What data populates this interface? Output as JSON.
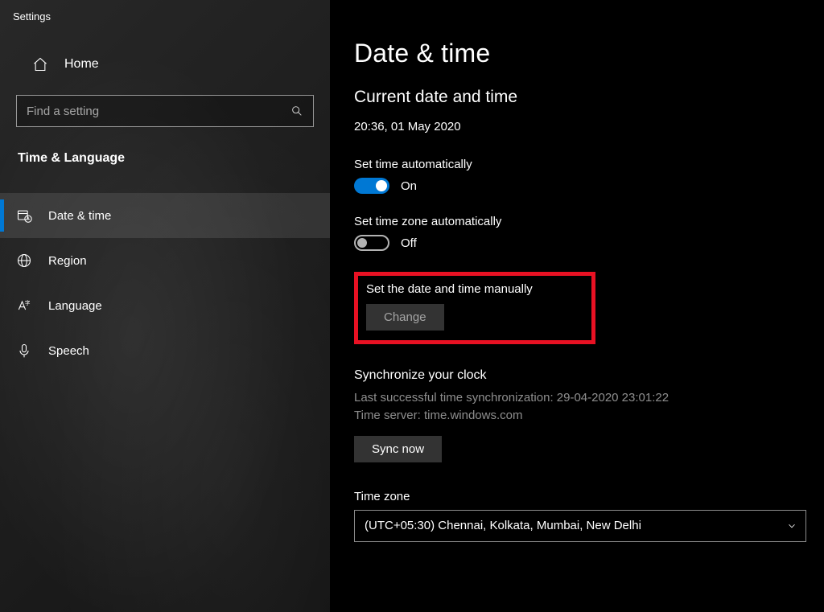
{
  "app_title": "Settings",
  "home_label": "Home",
  "search_placeholder": "Find a setting",
  "section": "Time & Language",
  "nav": [
    {
      "label": "Date & time"
    },
    {
      "label": "Region"
    },
    {
      "label": "Language"
    },
    {
      "label": "Speech"
    }
  ],
  "page": {
    "title": "Date & time",
    "current_heading": "Current date and time",
    "current_value": "20:36, 01 May 2020",
    "auto_time_label": "Set time automatically",
    "auto_time_state": "On",
    "auto_tz_label": "Set time zone automatically",
    "auto_tz_state": "Off",
    "manual_label": "Set the date and time manually",
    "change_btn": "Change",
    "sync_heading": "Synchronize your clock",
    "last_sync": "Last successful time synchronization: 29-04-2020 23:01:22",
    "time_server": "Time server: time.windows.com",
    "sync_btn": "Sync now",
    "tz_label": "Time zone",
    "tz_value": "(UTC+05:30) Chennai, Kolkata, Mumbai, New Delhi"
  }
}
